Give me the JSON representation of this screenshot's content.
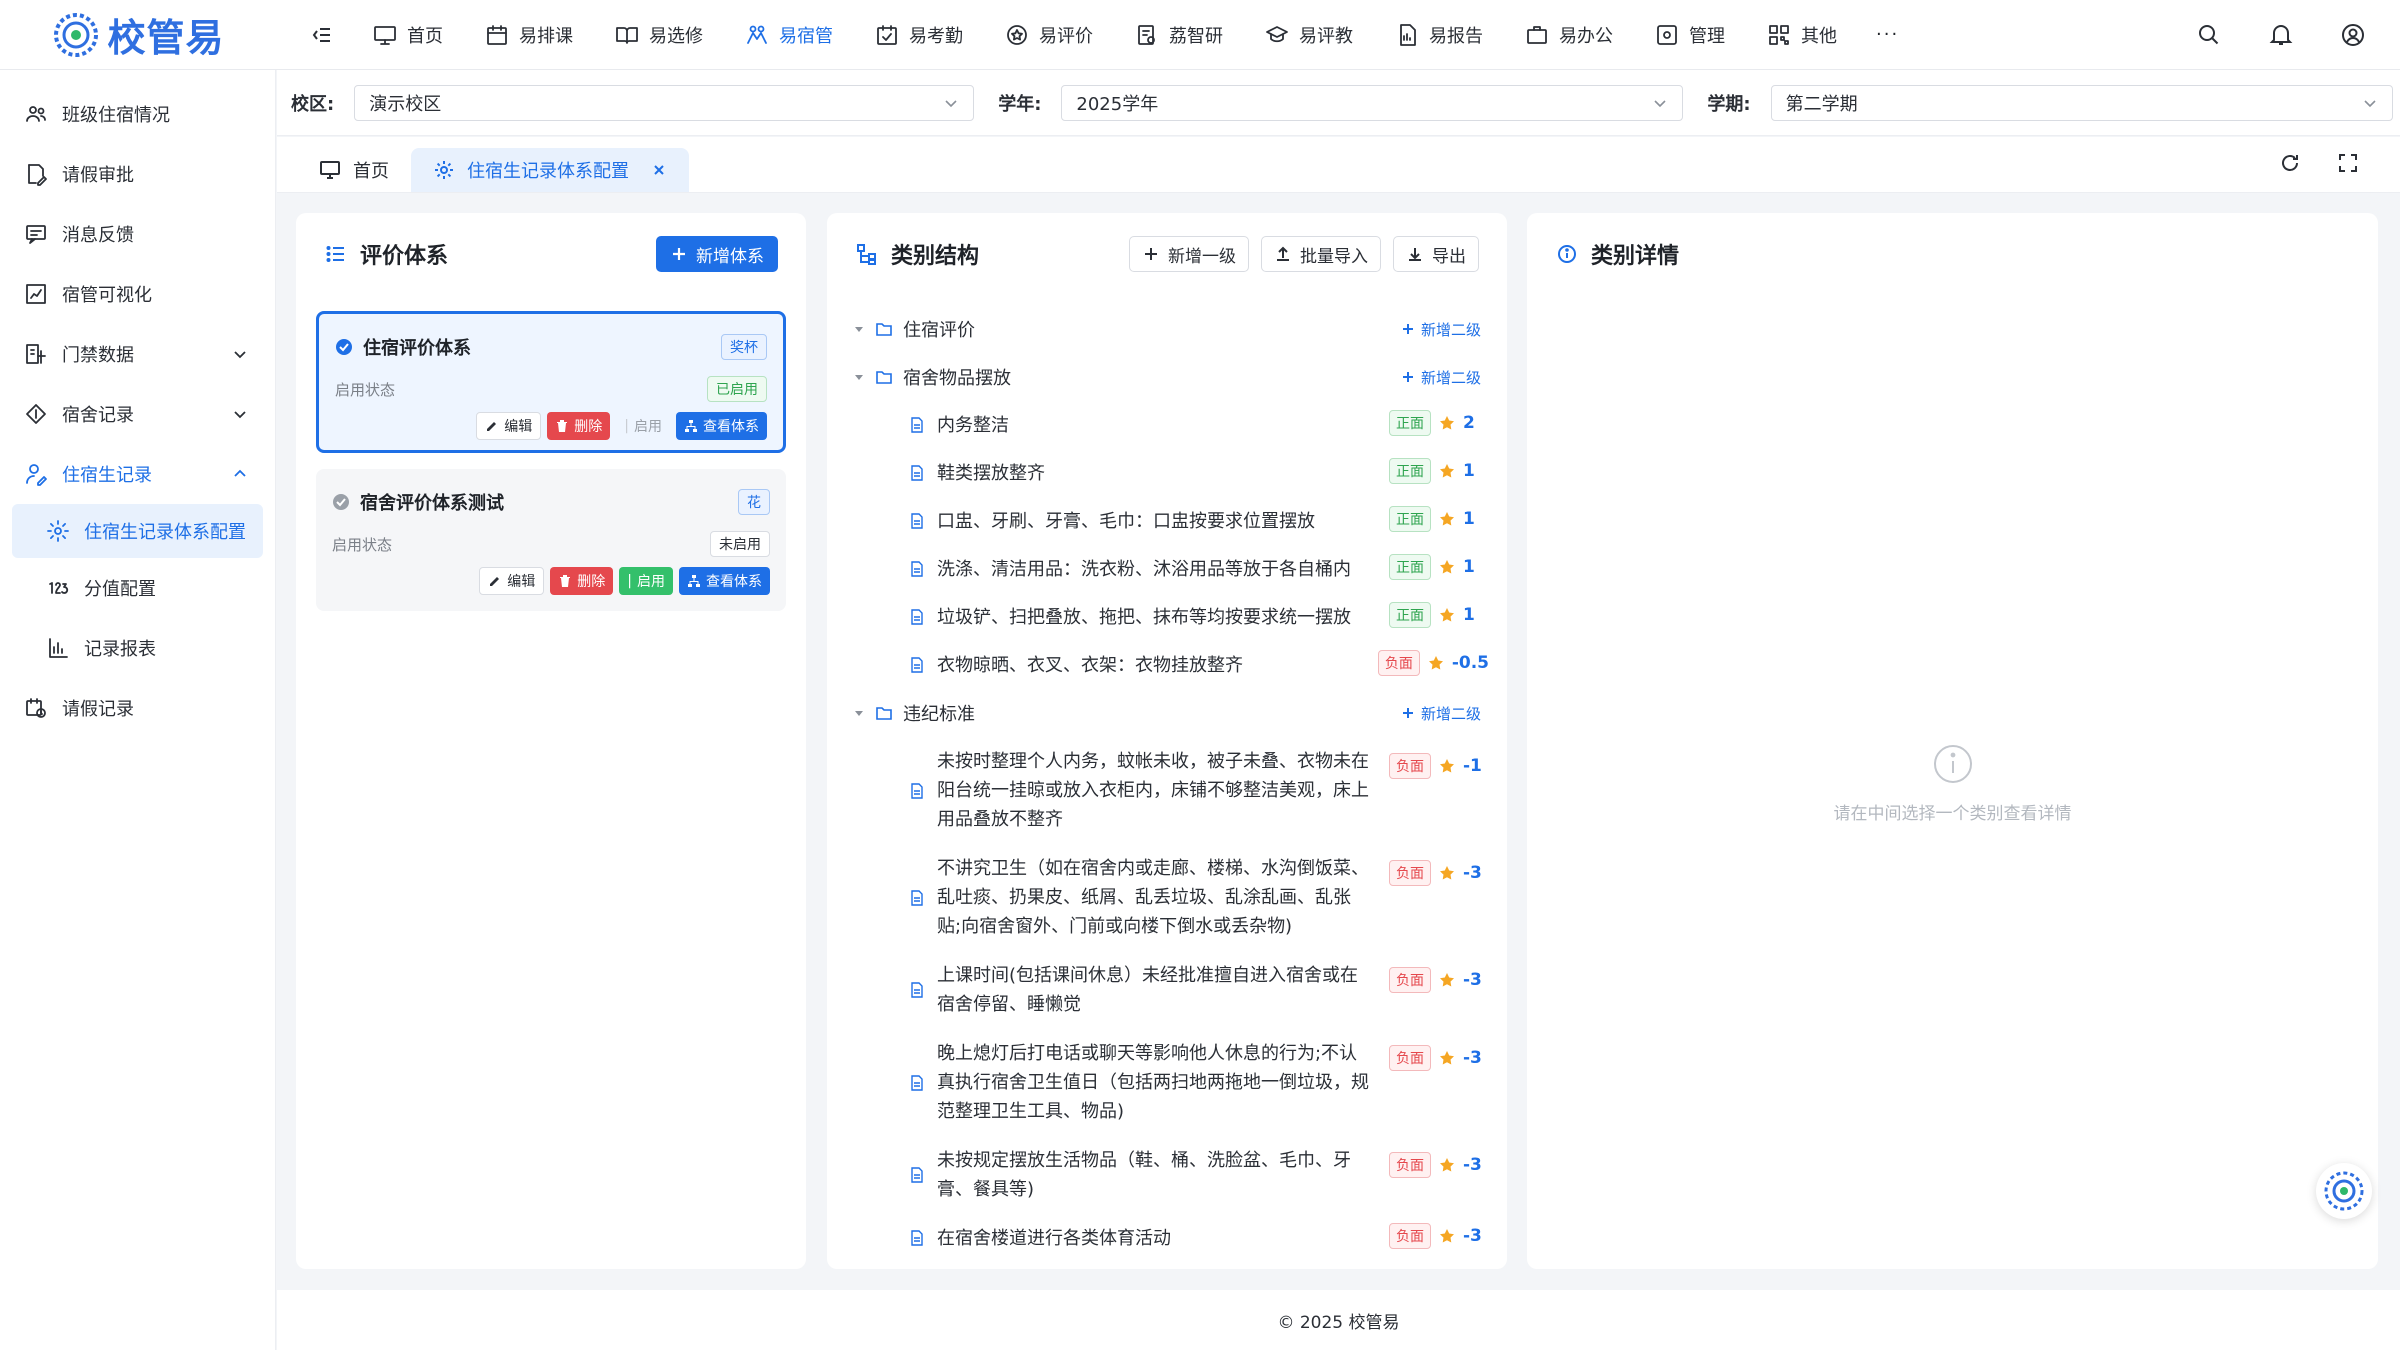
{
  "app": {
    "logo_text": "校管易"
  },
  "colors": {
    "accent": "#1e6fe6",
    "positive": "#2ea44f",
    "negative": "#e5484d",
    "star": "#f5a623"
  },
  "nav": {
    "items": [
      {
        "label": "首页",
        "icon": "monitor-icon"
      },
      {
        "label": "易排课",
        "icon": "calendar-icon"
      },
      {
        "label": "易选修",
        "icon": "book-open-icon"
      },
      {
        "label": "易宿管",
        "icon": "dorm-icon",
        "active": true
      },
      {
        "label": "易考勤",
        "icon": "calendar-check-icon"
      },
      {
        "label": "易评价",
        "icon": "star-badge-icon"
      },
      {
        "label": "荔智研",
        "icon": "research-icon"
      },
      {
        "label": "易评教",
        "icon": "graduation-cap-icon"
      },
      {
        "label": "易报告",
        "icon": "report-icon"
      },
      {
        "label": "易办公",
        "icon": "briefcase-icon"
      },
      {
        "label": "管理",
        "icon": "settings-square-icon"
      },
      {
        "label": "其他",
        "icon": "grid-icon"
      }
    ],
    "more_label": "···"
  },
  "sidebar": {
    "items": [
      {
        "label": "班级住宿情况",
        "icon": "users-icon"
      },
      {
        "label": "请假审批",
        "icon": "doc-edit-icon"
      },
      {
        "label": "消息反馈",
        "icon": "message-icon"
      },
      {
        "label": "宿管可视化",
        "icon": "chart-board-icon"
      },
      {
        "label": "门禁数据",
        "icon": "access-icon",
        "expandable": true
      },
      {
        "label": "宿舍记录",
        "icon": "diamond-icon",
        "expandable": true
      },
      {
        "label": "住宿生记录",
        "icon": "user-edit-icon",
        "expanded": true
      }
    ],
    "sub_items": [
      {
        "label": "住宿生记录体系配置",
        "icon": "gear-icon",
        "active": true
      },
      {
        "label": "分值配置",
        "icon": "numbers-icon"
      },
      {
        "label": "记录报表",
        "icon": "bar-chart-icon"
      }
    ],
    "last_item": {
      "label": "请假记录",
      "icon": "calendar-clock-icon"
    }
  },
  "filters": {
    "campus_label": "校区:",
    "campus_value": "演示校区",
    "year_label": "学年:",
    "year_value": "2025学年",
    "term_label": "学期:",
    "term_value": "第二学期"
  },
  "tabs": [
    {
      "label": "首页",
      "icon": "monitor-icon"
    },
    {
      "label": "住宿生记录体系配置",
      "icon": "gear-icon",
      "active": true
    }
  ],
  "systems_panel": {
    "title": "评价体系",
    "add_button": "新增体系",
    "cards": [
      {
        "name": "住宿评价体系",
        "tag": "奖杯",
        "status_label": "启用状态",
        "status": "已启用",
        "selected": true,
        "edit": "编辑",
        "delete": "删除",
        "enable": "启用",
        "view": "查看体系"
      },
      {
        "name": "宿舍评价体系测试",
        "tag": "花",
        "status_label": "启用状态",
        "status": "未启用",
        "selected": false,
        "edit": "编辑",
        "delete": "删除",
        "enable": "启用",
        "view": "查看体系"
      }
    ]
  },
  "structure_panel": {
    "title": "类别结构",
    "add_level1": "新增一级",
    "batch_import": "批量导入",
    "export": "导出",
    "add_level2": "新增二级",
    "groups": [
      {
        "name": "住宿评价",
        "items": []
      },
      {
        "name": "宿舍物品摆放",
        "items": [
          {
            "text": "内务整洁",
            "type": "正面",
            "score": "2"
          },
          {
            "text": "鞋类摆放整齐",
            "type": "正面",
            "score": "1"
          },
          {
            "text": "口盅、牙刷、牙膏、毛巾：口盅按要求位置摆放",
            "type": "正面",
            "score": "1"
          },
          {
            "text": "洗涤、清洁用品：洗衣粉、沐浴用品等放于各自桶内",
            "type": "正面",
            "score": "1"
          },
          {
            "text": "垃圾铲、扫把叠放、拖把、抹布等均按要求统一摆放",
            "type": "正面",
            "score": "1"
          },
          {
            "text": "衣物晾晒、衣叉、衣架：衣物挂放整齐",
            "type": "负面",
            "score": "-0.5"
          }
        ]
      },
      {
        "name": "违纪标准",
        "items": [
          {
            "text": "未按时整理个人内务，蚊帐未收，被子未叠、衣物未在阳台统一挂晾或放入衣柜内，床铺不够整洁美观，床上用品叠放不整齐",
            "type": "负面",
            "score": "-1"
          },
          {
            "text": "不讲究卫生（如在宿舍内或走廊、楼梯、水沟倒饭菜、乱吐痰、扔果皮、纸屑、乱丢垃圾、乱涂乱画、乱张贴;向宿舍窗外、门前或向楼下倒水或丢杂物)",
            "type": "负面",
            "score": "-3"
          },
          {
            "text": "上课时间(包括课间休息）未经批准擅自进入宿舍或在宿舍停留、睡懒觉",
            "type": "负面",
            "score": "-3"
          },
          {
            "text": "晚上熄灯后打电话或聊天等影响他人休息的行为;不认真执行宿舍卫生值日（包括两扫地两拖地一倒垃圾，规范整理卫生工具、物品)",
            "type": "负面",
            "score": "-3"
          },
          {
            "text": "未按规定摆放生活物品（鞋、桶、洗脸盆、毛巾、牙膏、餐具等)",
            "type": "负面",
            "score": "-3"
          },
          {
            "text": "在宿舍楼道进行各类体育活动",
            "type": "负面",
            "score": "-3"
          }
        ]
      }
    ]
  },
  "detail_panel": {
    "title": "类别详情",
    "empty_text": "请在中间选择一个类别查看详情"
  },
  "footer": {
    "text": "© 2025 校管易"
  }
}
